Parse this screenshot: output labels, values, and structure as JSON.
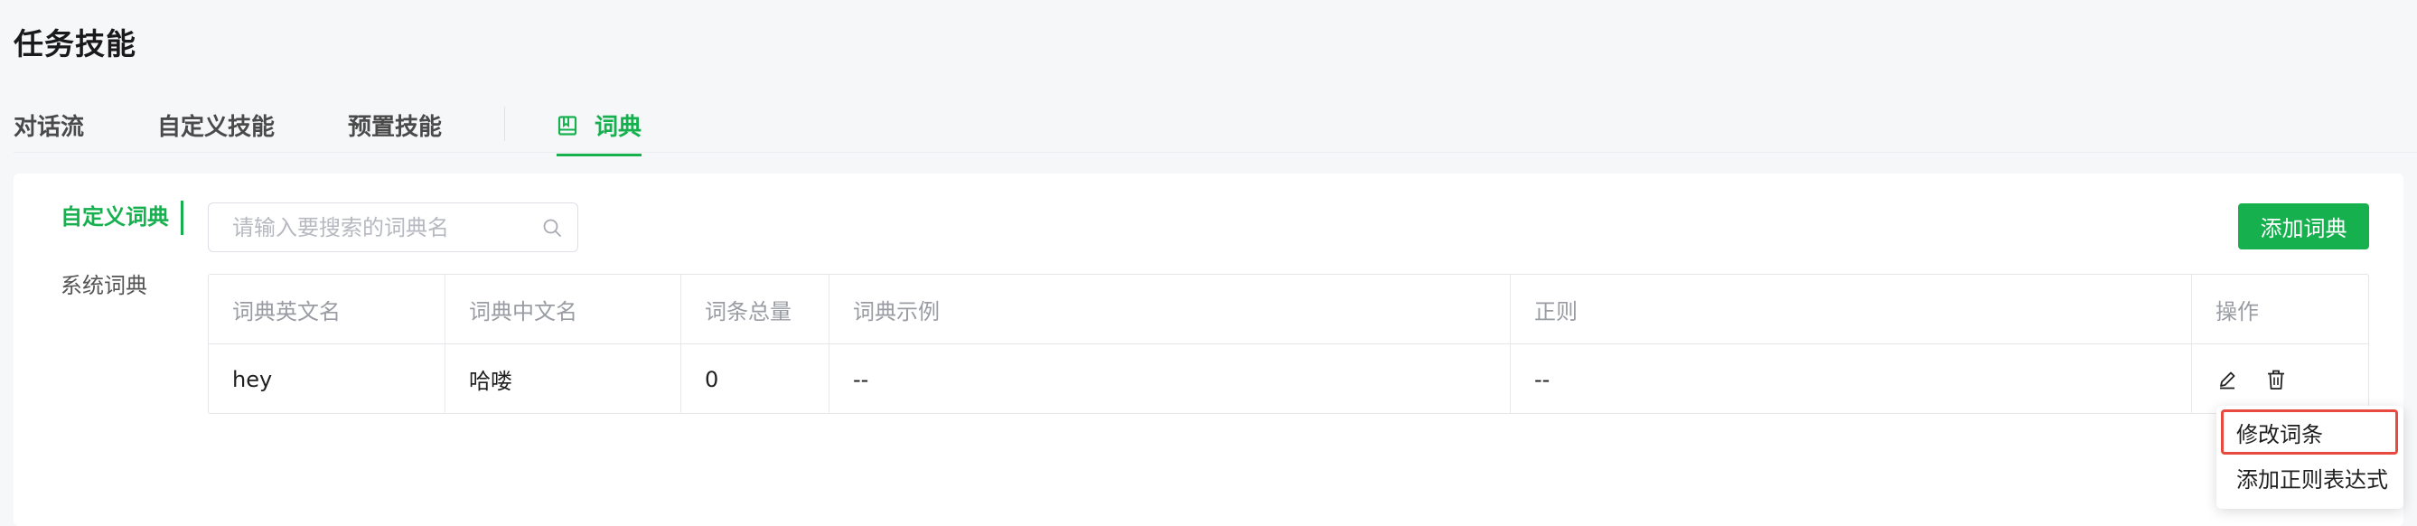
{
  "page": {
    "title": "任务技能"
  },
  "tabs": [
    {
      "label": "对话流"
    },
    {
      "label": "自定义技能"
    },
    {
      "label": "预置技能"
    },
    {
      "label": "词典",
      "icon": "dictionary-icon",
      "active": true
    }
  ],
  "sidebar": {
    "items": [
      {
        "label": "自定义词典",
        "active": true
      },
      {
        "label": "系统词典"
      }
    ]
  },
  "search": {
    "placeholder": "请输入要搜索的词典名",
    "value": "",
    "icon": "search-icon"
  },
  "toolbar": {
    "add_label": "添加词典"
  },
  "table": {
    "columns": [
      "词典英文名",
      "词典中文名",
      "词条总量",
      "词典示例",
      "正则",
      "操作"
    ],
    "rows": [
      {
        "en_name": "hey",
        "cn_name": "哈喽",
        "count": "0",
        "example": "--",
        "regex": "--",
        "actions": [
          "edit-icon",
          "delete-icon"
        ]
      }
    ]
  },
  "dropdown": {
    "items": [
      {
        "label": "修改词条",
        "highlighted": true
      },
      {
        "label": "添加正则表达式"
      }
    ]
  },
  "colors": {
    "accent": "#16b04e",
    "highlight_border": "#e84a3f"
  }
}
